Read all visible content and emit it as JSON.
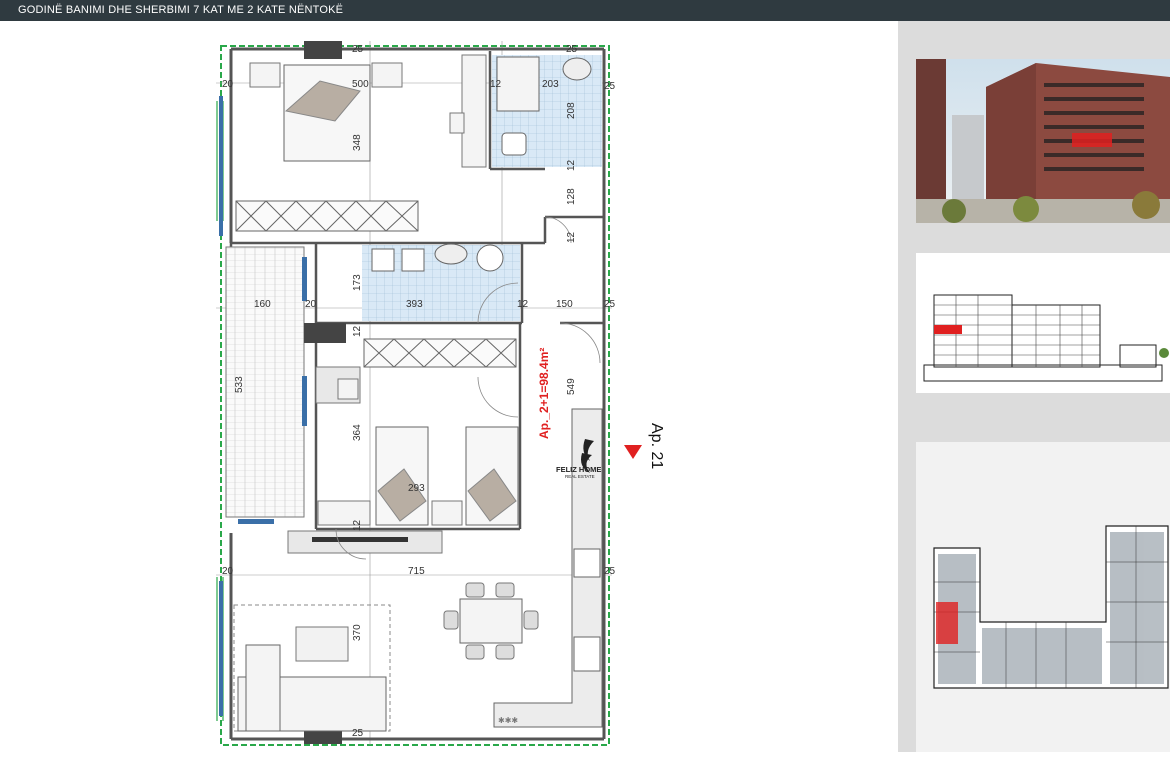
{
  "header": {
    "title": "GODINË BANIMI DHE SHERBIMI 7 KAT ME 2 KATE NËNTOKË"
  },
  "plan": {
    "unit_area": "Ap._2+1=98.4m²",
    "unit_number": "Ap. 21",
    "logo_text": "FELIZ HOME",
    "logo_subtext": "REAL ESTATE",
    "dimensions": {
      "d500": "500",
      "d348": "348",
      "d203": "203",
      "d208": "208",
      "d128": "128",
      "d160": "160",
      "d173": "173",
      "d393": "393",
      "d150": "150",
      "d533": "533",
      "d364": "364",
      "d549": "549",
      "d293": "293",
      "d715": "715",
      "d370": "370",
      "d25a": "25",
      "d25b": "25",
      "d25c": "25",
      "d25d": "25",
      "d25e": "25",
      "d25f": "25",
      "d20a": "20",
      "d20b": "20",
      "d12a": "12",
      "d12b": "12",
      "d12c": "12",
      "d12d": "12",
      "d12e": "12",
      "d12f": "12",
      "d20c": "20"
    }
  },
  "colors": {
    "header_bg": "#2f3a40",
    "accent_red": "#e02020",
    "wall": "#555555",
    "tile": "#cfe2f3",
    "green_boundary": "#2aa84a"
  }
}
